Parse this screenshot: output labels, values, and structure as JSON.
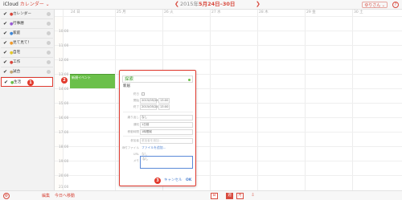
{
  "app": {
    "brand": "iCloud",
    "title": "カレンダー",
    "title_caret": "⌄"
  },
  "header": {
    "prev_arrow": "❮",
    "next_arrow": "❯",
    "date_year": "2015年",
    "date_range": "5月24日–30日",
    "user_label": "ゆりさん ⌄",
    "help": "?"
  },
  "sidebar": {
    "items": [
      {
        "label": "カレンダー",
        "color": "#d8453a",
        "checked": true
      },
      {
        "label": "行事暦",
        "color": "#9a5bd6",
        "checked": true
      },
      {
        "label": "家庭",
        "color": "#3b86d8",
        "checked": true
      },
      {
        "label": "見て見て！",
        "color": "#f09a2c",
        "checked": true
      },
      {
        "label": "自宅",
        "color": "#e5c82a",
        "checked": true
      },
      {
        "label": "工作",
        "color": "#d8453a",
        "checked": true
      },
      {
        "label": "試合",
        "color": "#c0a675",
        "checked": true
      },
      {
        "label": "生活",
        "color": "#6bc04a",
        "checked": true
      }
    ],
    "check": "✔",
    "dot": "●",
    "selected_badge": "1"
  },
  "week": {
    "days": [
      "24 日",
      "25 月",
      "26 火",
      "27 水",
      "28 木",
      "29 金",
      "30 土"
    ],
    "times": [
      "10:00",
      "11:00",
      "12:00",
      "13:00",
      "14:00",
      "15:00",
      "16:00",
      "17:00",
      "18:00",
      "19:00",
      "20:00",
      "21:00"
    ]
  },
  "event": {
    "title": "新規イベント",
    "badge": "2",
    "color": "#6bc04a"
  },
  "popover": {
    "title": "探索",
    "location": "新居",
    "allday_label": "終日",
    "start_label": "開始",
    "start_date": "2015/05/24",
    "start_time": "13:00",
    "end_label": "終了",
    "end_date": "2015/05/24",
    "end_time": "13:00",
    "timezone_label": "繰り返し",
    "timezone_value": "なし",
    "repeat_label": "通知",
    "repeat_value": "1日前",
    "travel_label": "移動時間",
    "travel_value": "1時間前",
    "invitees_label": "参加者",
    "invitees_placeholder": "参加者を追加...",
    "attach_label": "添付ファイル",
    "attach_link": "ファイルを追加...",
    "url_label": "URL",
    "url_value": "なし",
    "note_label": "メモ",
    "note_value": "なし",
    "badge": "3",
    "cancel": "キャンセル",
    "ok": "OK"
  },
  "footer": {
    "edit": "編集",
    "today": "今日へ移動",
    "views": [
      "日",
      "週",
      "月"
    ],
    "gear": "⚙"
  },
  "accent": "#d84a3e"
}
